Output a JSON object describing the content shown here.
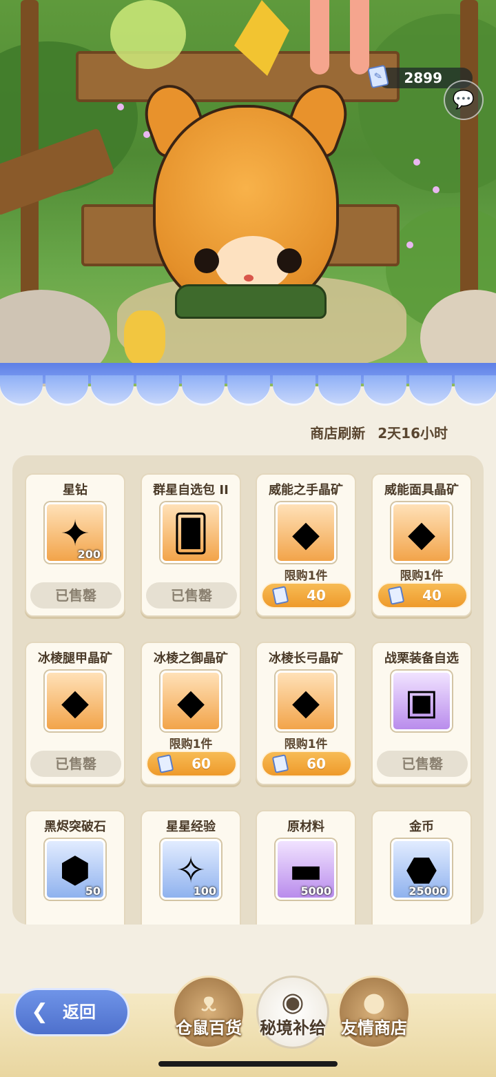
{
  "header": {
    "currency_value": "2899"
  },
  "shop": {
    "refresh_label": "商店刷新",
    "refresh_time": "2天16小时",
    "items": [
      {
        "name": "星钻",
        "icon": "star-diamond-icon",
        "qty": "200",
        "limit": "",
        "status": "已售罄",
        "price": "",
        "bg": "orange",
        "glyph": "✦"
      },
      {
        "name": "群星自选包 II",
        "icon": "card-pack-icon",
        "qty": "",
        "limit": "",
        "status": "已售罄",
        "price": "",
        "bg": "orange",
        "glyph": "🂠"
      },
      {
        "name": "威能之手晶矿",
        "icon": "crystal-ore-icon",
        "qty": "",
        "limit": "限购1件",
        "status": "",
        "price": "40",
        "bg": "orange",
        "glyph": "◆"
      },
      {
        "name": "威能面具晶矿",
        "icon": "crystal-ore-icon",
        "qty": "",
        "limit": "限购1件",
        "status": "",
        "price": "40",
        "bg": "orange",
        "glyph": "◆"
      },
      {
        "name": "冰棱腿甲晶矿",
        "icon": "ice-crystal-ore-icon",
        "qty": "",
        "limit": "",
        "status": "已售罄",
        "price": "",
        "bg": "orange",
        "glyph": "◆"
      },
      {
        "name": "冰棱之御晶矿",
        "icon": "ice-crystal-ore-icon",
        "qty": "",
        "limit": "限购1件",
        "status": "",
        "price": "60",
        "bg": "orange",
        "glyph": "◆"
      },
      {
        "name": "冰棱长弓晶矿",
        "icon": "ice-crystal-ore-icon",
        "qty": "",
        "limit": "限购1件",
        "status": "",
        "price": "60",
        "bg": "orange",
        "glyph": "◆"
      },
      {
        "name": "战栗装备自选",
        "icon": "treasure-chest-icon",
        "qty": "",
        "limit": "",
        "status": "已售罄",
        "price": "",
        "bg": "purple",
        "glyph": "▣"
      },
      {
        "name": "黑烬突破石",
        "icon": "breakthrough-stone-icon",
        "qty": "50",
        "limit": "",
        "status": "",
        "price": "",
        "bg": "blue",
        "glyph": "⬢"
      },
      {
        "name": "星星经验",
        "icon": "exp-card-icon",
        "qty": "100",
        "limit": "",
        "status": "",
        "price": "",
        "bg": "blue",
        "glyph": "✧"
      },
      {
        "name": "原材料",
        "icon": "ingot-icon",
        "qty": "5000",
        "limit": "",
        "status": "",
        "price": "",
        "bg": "purple",
        "glyph": "▬"
      },
      {
        "name": "金币",
        "icon": "gold-coin-icon",
        "qty": "25000",
        "limit": "",
        "status": "",
        "price": "",
        "bg": "blue",
        "glyph": "⬣"
      }
    ]
  },
  "bottom": {
    "back_label": "返回",
    "tabs": [
      {
        "label": "仓鼠百货",
        "icon": "hamster-icon",
        "active": false
      },
      {
        "label": "秘境补给",
        "icon": "eye-icon",
        "active": true
      },
      {
        "label": "友情商店",
        "icon": "crystal-ball-icon",
        "active": false
      }
    ]
  },
  "colors": {
    "accent_orange": "#ee9a2b",
    "awning_blue": "#5e7fe6",
    "panel_bg": "#e6ddc8",
    "back_button_blue": "#4e70cc"
  }
}
